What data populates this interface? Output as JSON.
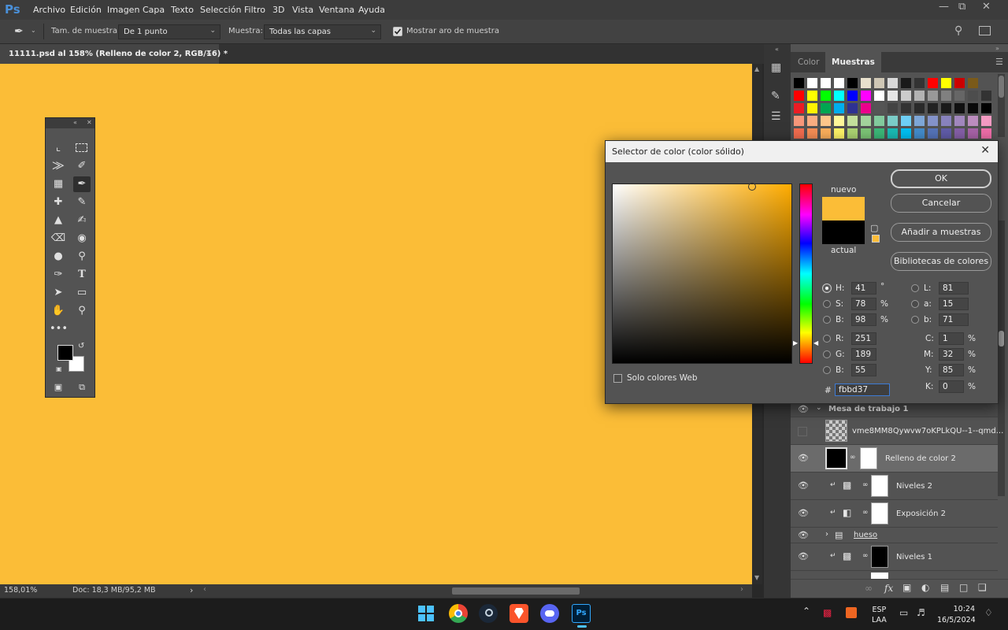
{
  "app": {
    "logo": "Ps"
  },
  "menu": [
    "Archivo",
    "Edición",
    "Imagen",
    "Capa",
    "Texto",
    "Selección",
    "Filtro",
    "3D",
    "Vista",
    "Ventana",
    "Ayuda"
  ],
  "options_bar": {
    "sample_size_label": "Tam. de muestra:",
    "sample_size_value": "De 1 punto",
    "sample_label": "Muestra:",
    "sample_value": "Todas las capas",
    "show_ring_label": "Mostrar aro de muestra",
    "show_ring_checked": true
  },
  "document": {
    "tab_title": "11111.psd al 158% (Relleno de color 2, RGB/16) *",
    "canvas_color": "#fbbd37",
    "zoom": "158,01%",
    "doc_size": "Doc: 18,3 MB/95,2 MB"
  },
  "right_panel": {
    "tabs": [
      "Color",
      "Muestras"
    ],
    "active_tab": "Muestras"
  },
  "swatches": {
    "row0": [
      "#000000",
      "#ffffff",
      "#ffffff",
      "#ffffff",
      "#000000",
      "#e8e0cc",
      "#cfc7b5",
      "#d9d9d9",
      "#1a1a1a",
      "#333333",
      "#ff0000",
      "#ffff00",
      "#cc0000",
      "#7a5a1a"
    ],
    "row1": [
      "#ff0000",
      "#ffff00",
      "#00ff00",
      "#00ffff",
      "#0000ff",
      "#ff00ff",
      "#ffffff",
      "#e6e6e6",
      "#cccccc",
      "#b3b3b3",
      "#999999",
      "#808080",
      "#666666",
      "#4d4d4d",
      "#333333"
    ],
    "row2": [
      "#ed1c24",
      "#fff200",
      "#00a651",
      "#00aeef",
      "#2e3192",
      "#ec008c",
      "#555555",
      "#444444",
      "#333333",
      "#2a2a2a",
      "#222222",
      "#1a1a1a",
      "#111111",
      "#0a0a0a",
      "#000000"
    ],
    "row3": [
      "#f7977a",
      "#f9ad81",
      "#fdc68a",
      "#fff79a",
      "#c4df9b",
      "#a3d39c",
      "#82ca9d",
      "#7bcdc8",
      "#6ecff6",
      "#7ea7d8",
      "#8493ca",
      "#8882be",
      "#a187be",
      "#bc8dbf",
      "#f49ac2"
    ],
    "row4": [
      "#f26c4f",
      "#f68e55",
      "#fbaf5c",
      "#fff467",
      "#acd372",
      "#7cc576",
      "#3bb878",
      "#1abbb4",
      "#00bff3",
      "#438ccb",
      "#5574b9",
      "#605ca8",
      "#855fa8",
      "#a763a8",
      "#f06ea9"
    ]
  },
  "layers": {
    "group_name": "Mesa de trabajo 1",
    "items": [
      {
        "name": "vme8MM8Qywvw7oKPLkQU--1--qmd...",
        "visible": false
      },
      {
        "name": "Relleno de color 2",
        "visible": true,
        "selected": true
      },
      {
        "name": "Niveles 2",
        "visible": true
      },
      {
        "name": "Exposición 2",
        "visible": true
      },
      {
        "name": "hueso",
        "visible": true
      },
      {
        "name": "Niveles 1",
        "visible": true
      }
    ]
  },
  "color_picker": {
    "title": "Selector de color (color sólido)",
    "new_label": "nuevo",
    "current_label": "actual",
    "new_color": "#fbbd37",
    "current_color": "#000000",
    "buttons": {
      "ok": "OK",
      "cancel": "Cancelar",
      "add_swatch": "Añadir a muestras",
      "libraries": "Bibliotecas de colores"
    },
    "web_only_label": "Solo colores Web",
    "hsb": {
      "H": "41",
      "S": "78",
      "B": "98",
      "deg": "°",
      "pct": "%"
    },
    "lab": {
      "L": "81",
      "a": "15",
      "b": "71"
    },
    "rgb": {
      "R": "251",
      "G": "189",
      "B": "55"
    },
    "cmyk": {
      "C": "1",
      "M": "32",
      "Y": "85",
      "K": "0",
      "pct": "%"
    },
    "hex_label": "#",
    "hex": "fbbd37",
    "field_labels": {
      "H": "H:",
      "S": "S:",
      "B": "B:",
      "L": "L:",
      "a": "a:",
      "b": "b:",
      "R": "R:",
      "G": "G:",
      "B2": "B:",
      "C": "C:",
      "M": "M:",
      "Y": "Y:",
      "K": "K:"
    }
  },
  "taskbar": {
    "lang": "ESP",
    "lang_sub": "LAA",
    "time": "10:24",
    "date": "16/5/2024"
  }
}
